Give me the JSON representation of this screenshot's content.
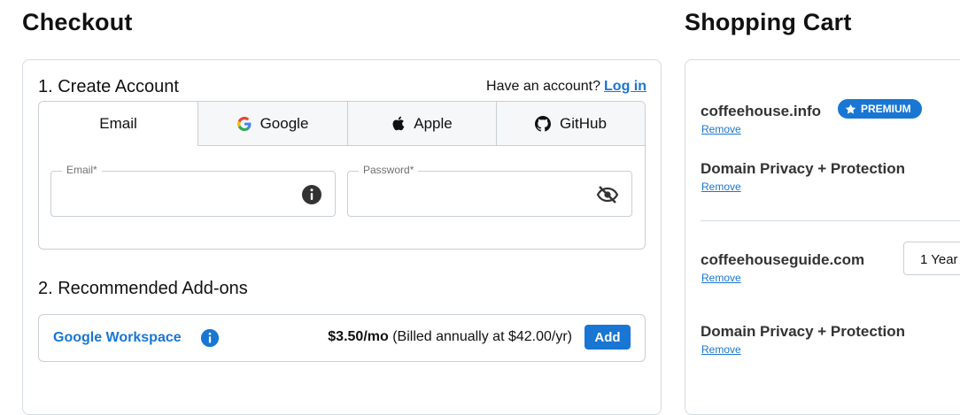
{
  "checkout": {
    "title": "Checkout",
    "section1_title": "1. Create Account",
    "have_account_text": "Have an account?",
    "login_link": "Log in",
    "tabs": [
      {
        "label": "Email",
        "icon": "email"
      },
      {
        "label": "Google",
        "icon": "google-icon"
      },
      {
        "label": "Apple",
        "icon": "apple-icon"
      },
      {
        "label": "GitHub",
        "icon": "github-icon"
      }
    ],
    "email_field": {
      "label": "Email*",
      "value": ""
    },
    "password_field": {
      "label": "Password*",
      "value": ""
    },
    "section2_title": "2. Recommended Add-ons",
    "addon": {
      "name": "Google Workspace",
      "price": "$3.50/mo",
      "billing": "(Billed annually at $42.00/yr)",
      "add_label": "Add"
    }
  },
  "cart": {
    "title": "Shopping Cart",
    "items": [
      {
        "name": "coffeehouse.info",
        "remove": "Remove",
        "badge": "PREMIUM"
      },
      {
        "name": "Domain Privacy + Protection",
        "remove": "Remove"
      },
      {
        "name": "coffeehouseguide.com",
        "remove": "Remove",
        "term": "1 Year -"
      },
      {
        "name": "Domain Privacy + Protection",
        "remove": "Remove"
      }
    ]
  },
  "colors": {
    "accent": "#1976d2",
    "border": "#c8cfd4",
    "tab_bg": "#f5f7f8"
  }
}
